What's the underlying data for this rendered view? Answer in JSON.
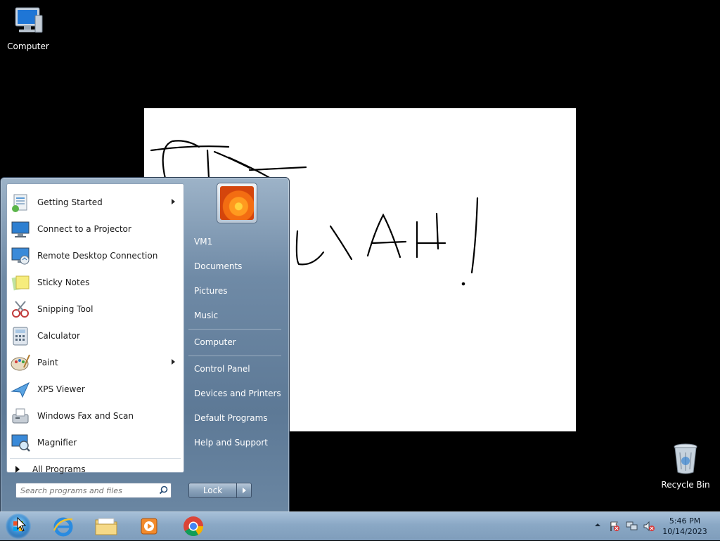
{
  "desktop": {
    "computer_label": "Computer",
    "recycle_label": "Recycle Bin"
  },
  "start_menu": {
    "programs": [
      {
        "label": "Getting Started",
        "icon": "getting-started-icon",
        "has_arrow": true
      },
      {
        "label": "Connect to a Projector",
        "icon": "projector-icon",
        "has_arrow": false
      },
      {
        "label": "Remote Desktop Connection",
        "icon": "remote-desktop-icon",
        "has_arrow": false
      },
      {
        "label": "Sticky Notes",
        "icon": "sticky-notes-icon",
        "has_arrow": false
      },
      {
        "label": "Snipping Tool",
        "icon": "scissors-icon",
        "has_arrow": false
      },
      {
        "label": "Calculator",
        "icon": "calculator-icon",
        "has_arrow": false
      },
      {
        "label": "Paint",
        "icon": "paint-palette-icon",
        "has_arrow": true
      },
      {
        "label": "XPS Viewer",
        "icon": "xps-viewer-icon",
        "has_arrow": false
      },
      {
        "label": "Windows Fax and Scan",
        "icon": "fax-icon",
        "has_arrow": false
      },
      {
        "label": "Magnifier",
        "icon": "magnifier-icon",
        "has_arrow": false
      }
    ],
    "all_programs": "All Programs",
    "search_placeholder": "Search programs and files",
    "right_links": {
      "user": "VM1",
      "documents": "Documents",
      "pictures": "Pictures",
      "music": "Music",
      "computer": "Computer",
      "control_panel": "Control Panel",
      "devices": "Devices and Printers",
      "default_programs": "Default Programs",
      "help": "Help and Support"
    },
    "lock_label": "Lock"
  },
  "taskbar": {
    "time": "5:46 PM",
    "date": "10/14/2023",
    "pinned": [
      "internet-explorer-icon",
      "folder-icon",
      "media-player-icon",
      "chrome-icon"
    ]
  }
}
